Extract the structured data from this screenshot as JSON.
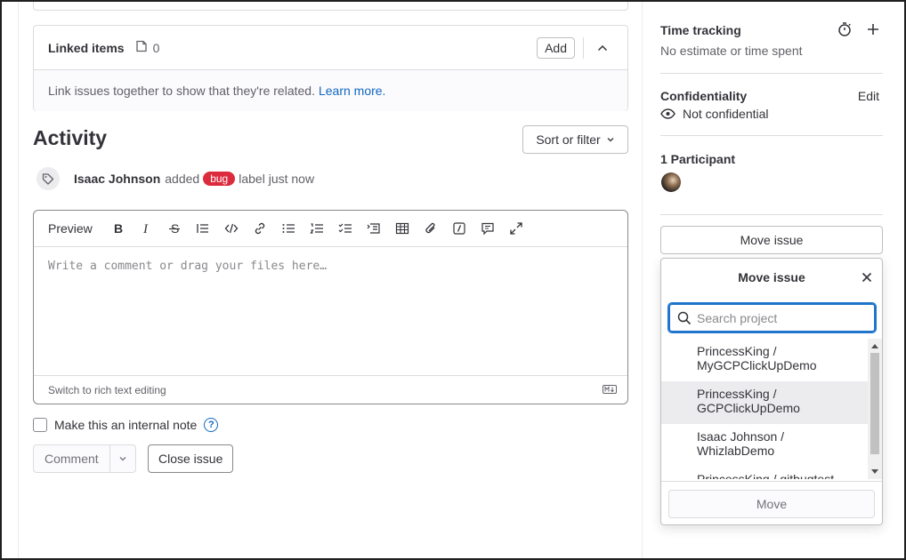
{
  "linked_items": {
    "title": "Linked items",
    "count": "0",
    "add_label": "Add",
    "body_text": "Link issues together to show that they're related.",
    "learn_more": "Learn more."
  },
  "activity": {
    "title": "Activity",
    "sort_label": "Sort or filter",
    "event": {
      "author": "Isaac Johnson",
      "verb": "added",
      "label": "bug",
      "suffix": "label just now"
    }
  },
  "editor": {
    "preview_label": "Preview",
    "placeholder": "Write a comment or drag your files here…",
    "switch_label": "Switch to rich text editing",
    "toolbar_icons": [
      "bold-icon",
      "italic-icon",
      "strikethrough-icon",
      "quote-icon",
      "code-icon",
      "link-icon",
      "bullet-list-icon",
      "numbered-list-icon",
      "task-list-icon",
      "collapsible-icon",
      "table-icon",
      "attach-icon",
      "slash-command-icon",
      "comment-template-icon",
      "fullscreen-icon"
    ]
  },
  "internal_note": {
    "label": "Make this an internal note"
  },
  "actions": {
    "comment_label": "Comment",
    "close_label": "Close issue"
  },
  "sidebar": {
    "time_tracking": {
      "title": "Time tracking",
      "value": "No estimate or time spent"
    },
    "confidentiality": {
      "title": "Confidentiality",
      "edit_label": "Edit",
      "value": "Not confidential"
    },
    "participants": {
      "title": "1 Participant"
    },
    "move_issue_label": "Move issue"
  },
  "move_dropdown": {
    "title": "Move issue",
    "search_placeholder": "Search project",
    "projects": [
      {
        "line1": "PrincessKing /",
        "line2": "MyGCPClickUpDemo"
      },
      {
        "line1": "PrincessKing /",
        "line2": "GCPClickUpDemo"
      },
      {
        "line1": "Isaac Johnson /",
        "line2": "WhizlabDemo"
      },
      {
        "line1": "PrincessKing / gitbugtest",
        "line2": ""
      }
    ],
    "move_label": "Move"
  },
  "colors": {
    "accent": "#1068bf",
    "bug_label": "#dd2b3e",
    "focus_border": "#1f75cb"
  }
}
